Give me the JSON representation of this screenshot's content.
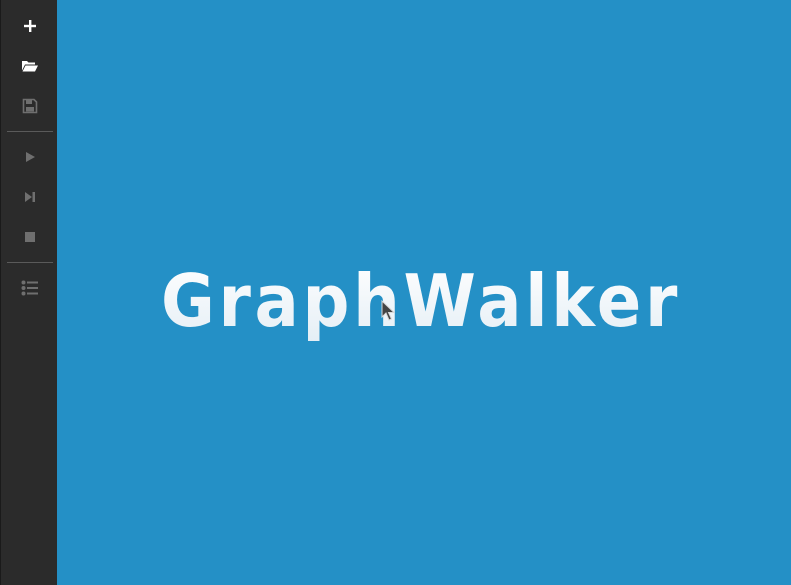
{
  "logo": {
    "text": "GraphWalker"
  },
  "toolbar": {
    "items": [
      {
        "icon": "plus-icon",
        "enabled": true
      },
      {
        "icon": "folder-open-icon",
        "enabled": true
      },
      {
        "icon": "save-icon",
        "enabled": false
      },
      {
        "icon": "play-icon",
        "enabled": false
      },
      {
        "icon": "step-forward-icon",
        "enabled": false
      },
      {
        "icon": "stop-icon",
        "enabled": false
      },
      {
        "icon": "list-icon",
        "enabled": false
      }
    ]
  },
  "colors": {
    "background": "#2490c6",
    "sidebar": "#2b2b2b",
    "icon_enabled": "#ffffff",
    "icon_disabled": "#6f6f6f",
    "logo": "#f2f6f9"
  }
}
